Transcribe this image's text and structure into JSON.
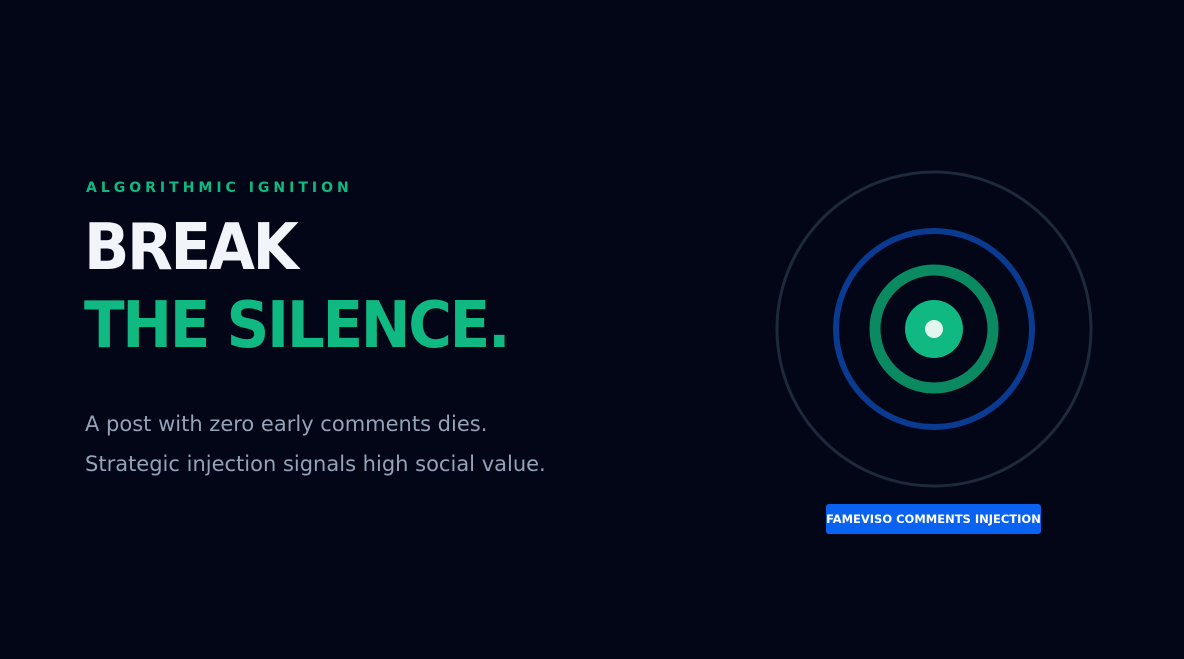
{
  "hero": {
    "eyebrow": "ALGORITHMIC IGNITION",
    "headline_line1": "BREAK",
    "headline_line2": "THE SILENCE.",
    "body_line1": "A post with zero early comments dies.",
    "body_line2": "Strategic injection signals high social value."
  },
  "graphic": {
    "icon": "target-rings-icon",
    "colors": {
      "outer_ring": "#1e293b",
      "middle_ring": "#0b3a91",
      "inner_ring": "#0b8a62",
      "core": "#10b981",
      "center_dot": "#e2f5ee"
    }
  },
  "cta": {
    "label": "FAMEVISO COMMENTS INJECTION",
    "color": "#0a62f0"
  },
  "theme": {
    "background": "#020617",
    "accent": "#10b981",
    "text_primary": "#f1f5f9",
    "text_muted": "#94a3b8"
  }
}
